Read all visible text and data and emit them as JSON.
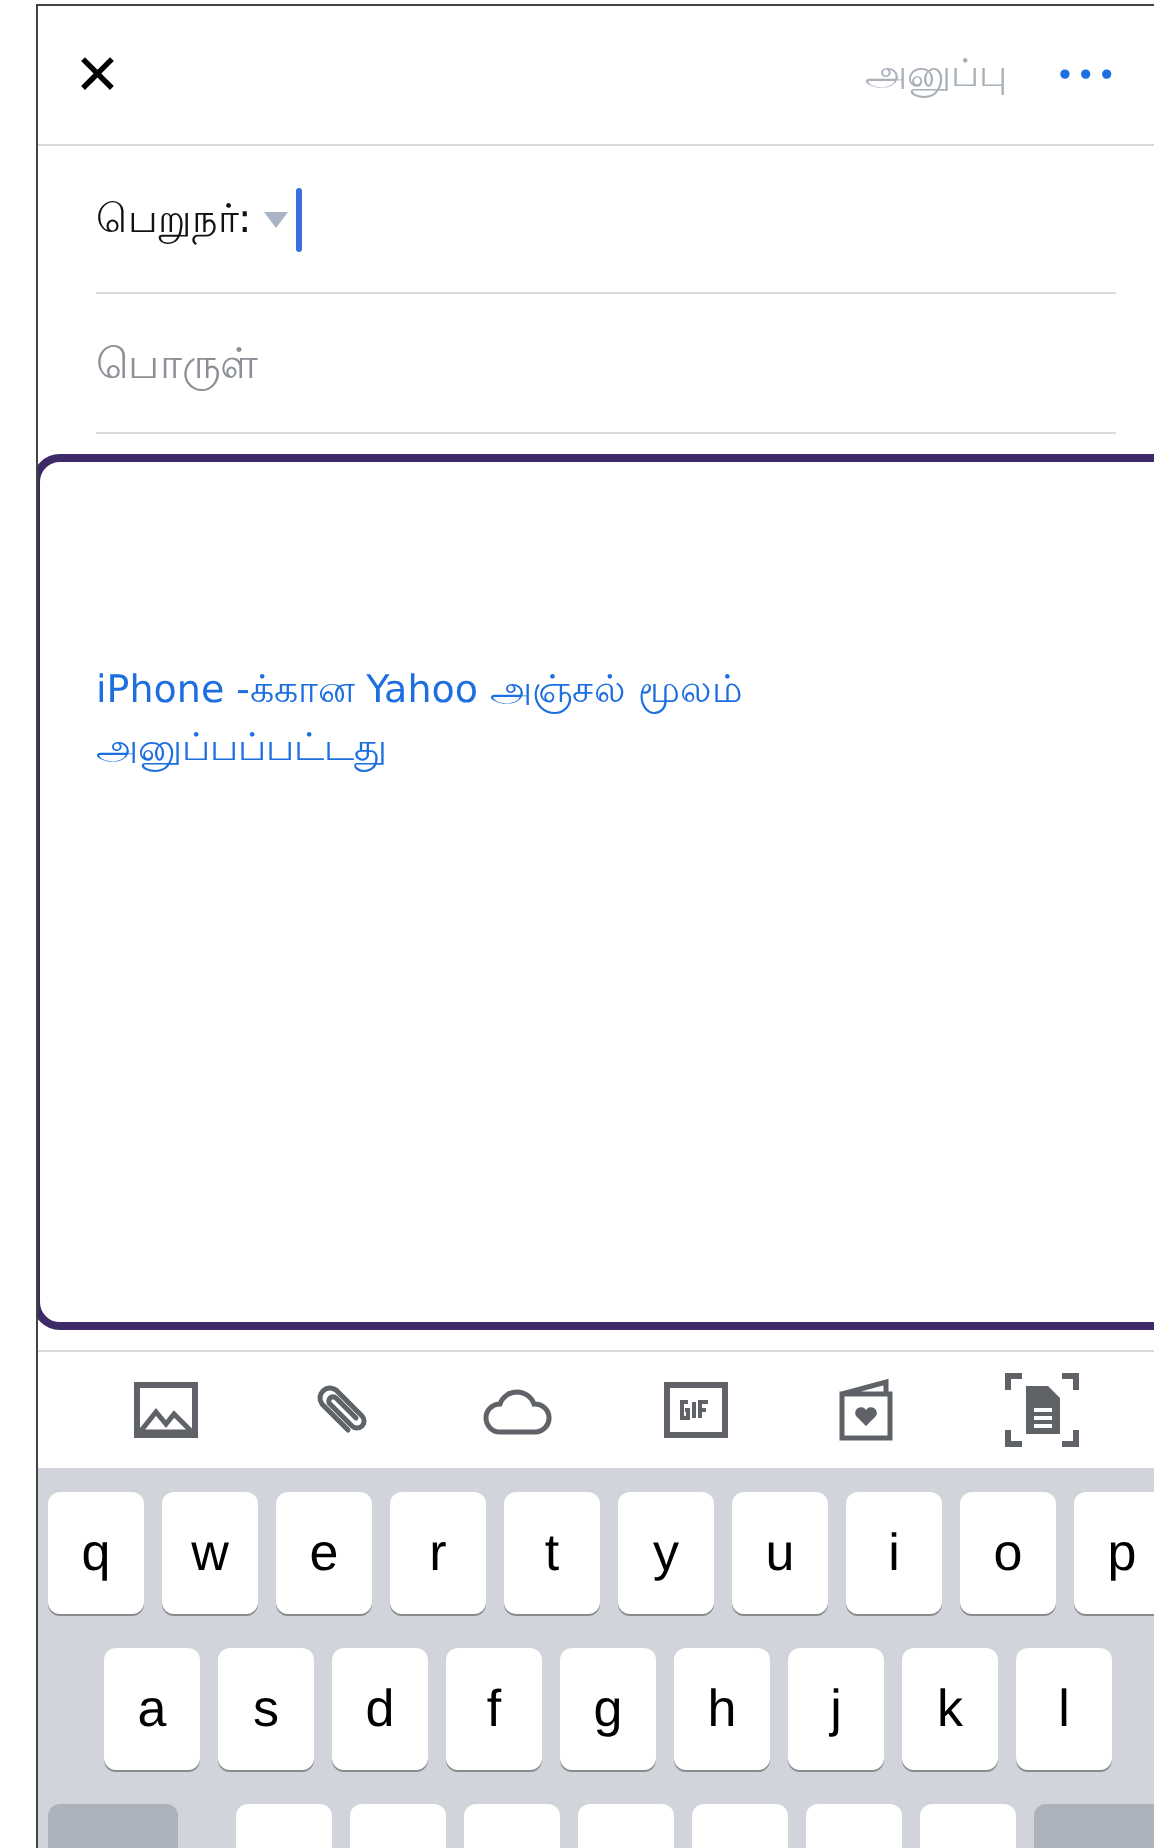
{
  "header": {
    "close": "✕",
    "send": {
      "label": "அனுப்பு",
      "disabled": true
    },
    "more": "•••"
  },
  "recipient": {
    "label": "பெறுநர்:",
    "focused": true
  },
  "subject": {
    "placeholder": "பொருள்"
  },
  "body": {
    "signature": "iPhone -க்கான Yahoo அஞ்சல் மூலம் அனுப்பப்பட்டது"
  },
  "toolbar": [
    {
      "kind": "photo"
    },
    {
      "kind": "attach"
    },
    {
      "kind": "cloud"
    },
    {
      "kind": "gif"
    },
    {
      "kind": "card"
    },
    {
      "kind": "scan"
    }
  ],
  "keyboard": {
    "rows": [
      [
        "q",
        "w",
        "e",
        "r",
        "t",
        "y",
        "u",
        "i",
        "o",
        "p"
      ],
      [
        "a",
        "s",
        "d",
        "f",
        "g",
        "h",
        "j",
        "k",
        "l"
      ]
    ]
  }
}
